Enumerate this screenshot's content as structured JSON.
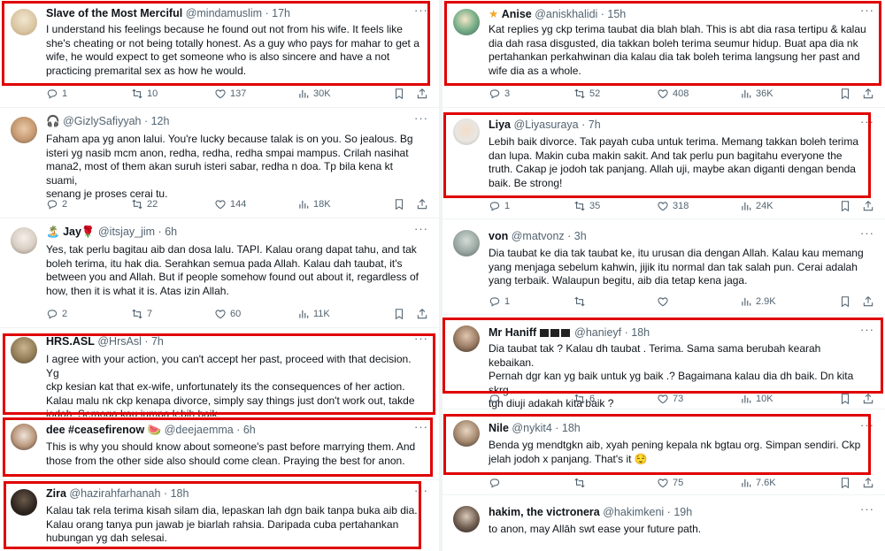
{
  "colors": {
    "highlight": "#e00000",
    "text": "#0f1419",
    "muted": "#536471",
    "divider": "#eff3f4"
  },
  "left": [
    {
      "name": "Slave of the Most Merciful",
      "handle": "@mindamuslim",
      "time": "17h",
      "lines": [
        "I understand his feelings because he found out not from his wife. It feels like",
        "she's cheating or not being totally honest. As a guy who pays for mahar to get a",
        "wife, he would expect to get someone who is also sincere and have a not",
        "practicing premarital sex as how he would."
      ],
      "replies": "1",
      "retweets": "10",
      "likes": "137",
      "views": "30K"
    },
    {
      "name": "",
      "handle": "@GizlySafiyyah",
      "time": "12h",
      "lines": [
        "Faham apa yg anon lalui. You're lucky because talak is on you. So jealous. Bg",
        "isteri yg nasib mcm anon, redha, redha, redha smpai mampus. Crilah nasihat",
        "mana2, most of them akan suruh isteri sabar, redha n doa. Tp bila kena kt suami,",
        "senang je proses cerai tu."
      ],
      "replies": "2",
      "retweets": "22",
      "likes": "144",
      "views": "18K"
    },
    {
      "name": "Jay",
      "handle": "@itsjay_jim",
      "time": "6h",
      "lines": [
        "Yes, tak perlu bagitau aib dan dosa lalu. TAPI. Kalau orang dapat tahu, and tak",
        "boleh terima, itu hak dia. Serahkan semua pada Allah. Kalau dah taubat, it's",
        "between you and Allah. But if people somehow found out about it, regardless of",
        "how, then it is what it is. Atas izin Allah."
      ],
      "replies": "2",
      "retweets": "7",
      "likes": "60",
      "views": "11K"
    },
    {
      "name": "HRS.ASL",
      "handle": "@HrsAsl",
      "time": "7h",
      "lines": [
        "I agree with your action, you can't accept her past, proceed with that decision. Yg",
        "ckp kesian kat that ex-wife, unfortunately its the consequences of her action.",
        "Kalau malu nk ckp kenapa divorce, simply say things just don't work out, takde",
        "jodoh. Semoga kau jumpa lebih baik."
      ]
    },
    {
      "name": "dee #ceasefirenow",
      "handle": "@deejaemma",
      "time": "6h",
      "lines": [
        "This is why you should know about someone's past before marrying them. And",
        "those from the other side also should come clean. Praying the best for anon."
      ]
    },
    {
      "name": "Zira",
      "handle": "@hazirahfarhanah",
      "time": "18h",
      "lines": [
        "Kalau tak rela terima kisah silam dia, lepaskan lah dgn baik tanpa buka aib dia.",
        "Kalau orang tanya pun jawab je biarlah rahsia. Daripada cuba pertahankan",
        "hubungan yg dah selesai."
      ]
    }
  ],
  "right": [
    {
      "name": "Anise",
      "handle": "@aniskhalidi",
      "time": "15h",
      "lines": [
        "Kat replies yg ckp terima taubat dia blah blah. This is abt dia rasa tertipu & kalau",
        "dia dah rasa disgusted, dia takkan boleh terima seumur hidup. Buat apa dia nk",
        "pertahankan perkahwinan dia kalau dia tak boleh terima langsung her past and",
        "wife dia as a whole."
      ],
      "replies": "3",
      "retweets": "52",
      "likes": "408",
      "views": "36K"
    },
    {
      "name": "Liya",
      "handle": "@Liyasuraya",
      "time": "7h",
      "lines": [
        "Lebih baik divorce. Tak payah cuba untuk terima. Memang takkan boleh terima",
        "dan lupa. Makin cuba makin sakit. And tak perlu pun bagitahu everyone the",
        "truth. Cakap je jodoh tak panjang. Allah uji, maybe akan diganti dengan benda",
        "baik. Be strong!"
      ],
      "replies": "1",
      "retweets": "35",
      "likes": "318",
      "views": "24K"
    },
    {
      "name": "von",
      "handle": "@matvonz",
      "time": "3h",
      "lines": [
        "Dia taubat ke dia tak taubat ke, itu urusan dia dengan Allah. Kalau kau memang",
        "yang menjaga sebelum kahwin, jijik itu normal dan tak salah pun. Cerai adalah",
        "yang terbaik. Walaupun begitu, aib dia tetap kena jaga."
      ],
      "replies": "1",
      "retweets": "",
      "likes": "",
      "views": "2.9K"
    },
    {
      "name": "Mr Haniff",
      "handle": "@hanieyf",
      "time": "18h",
      "lines": [
        "Dia taubat tak ? Kalau dh taubat . Terima. Sama sama berubah kearah kebaikan.",
        "Pernah dgr kan yg baik untuk yg baik .? Bagaimana kalau dia dh baik. Dn kita skrg",
        "tgh diuji adakah kita baik ?"
      ],
      "replies": "",
      "retweets": "6",
      "likes": "73",
      "views": "10K"
    },
    {
      "name": "Nile",
      "handle": "@nykit4",
      "time": "18h",
      "lines": [
        "Benda yg mendtgkn aib, xyah pening kepala nk bgtau org. Simpan sendiri. Ckp",
        "jelah jodoh x panjang. That's it 😌"
      ],
      "replies": "",
      "retweets": "",
      "likes": "75",
      "views": "7.6K"
    },
    {
      "name": "hakim, the victronera",
      "handle": "@hakimkeni",
      "time": "19h",
      "lines": [
        "to anon, may Allāh swt ease your future path."
      ]
    }
  ]
}
